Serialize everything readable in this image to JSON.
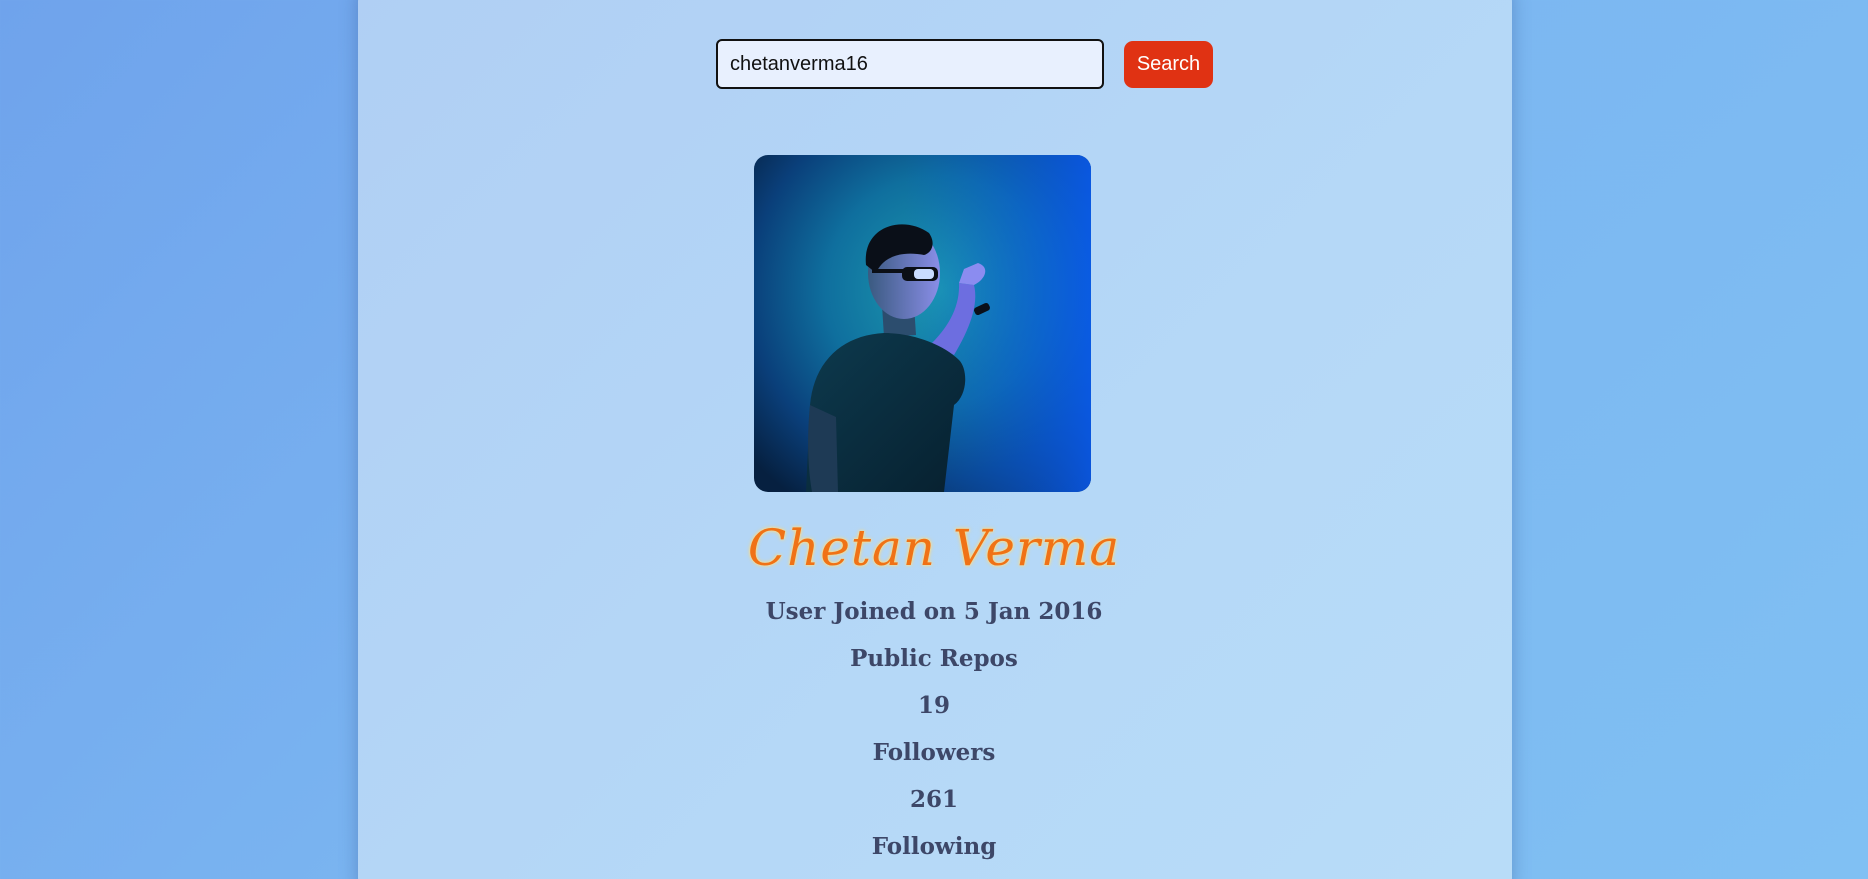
{
  "search": {
    "value": "chetanverma16",
    "button_label": "Search"
  },
  "profile": {
    "avatar_icon": "user-photo",
    "name": "Chetan Verma",
    "joined": "User Joined on 5 Jan 2016",
    "public_repos_label": "Public Repos",
    "public_repos": "19",
    "followers_label": "Followers",
    "followers": "261",
    "following_label": "Following"
  },
  "colors": {
    "page_background": "#75aeee",
    "card_background": "#b5d8f7",
    "button": "#e03213",
    "name": "#f07216",
    "stat_text": "#3d4768"
  }
}
